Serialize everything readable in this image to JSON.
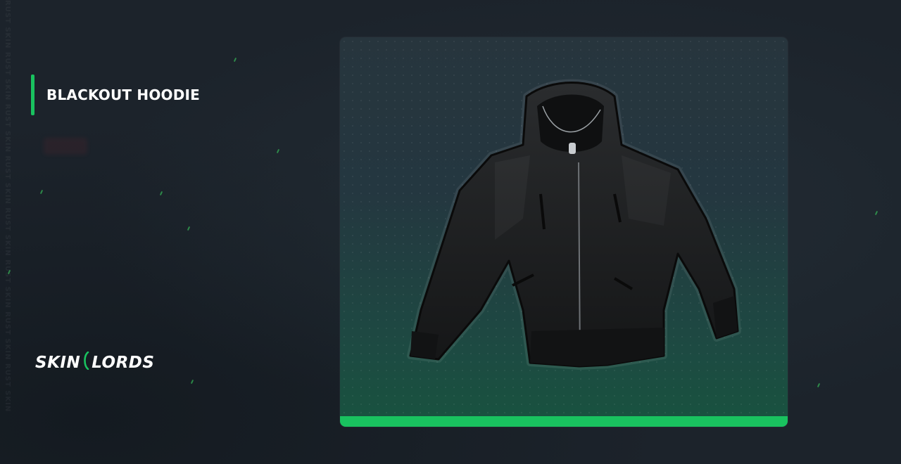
{
  "page": {
    "watermark": "RUST SKIN RUST SKIN RUST SKIN RUST SKIN RUST SKIN RUST SKIN RUST SKIN RUST SKIN",
    "title": "BLACKOUT HOODIE",
    "brand": {
      "left": "SKIN",
      "right": "LORDS"
    }
  },
  "item": {
    "icon": "hoodie-icon"
  },
  "colors": {
    "accent": "#19c25f",
    "background": "#1c232b",
    "card_top": "#27353d",
    "card_bottom": "#18533f"
  }
}
